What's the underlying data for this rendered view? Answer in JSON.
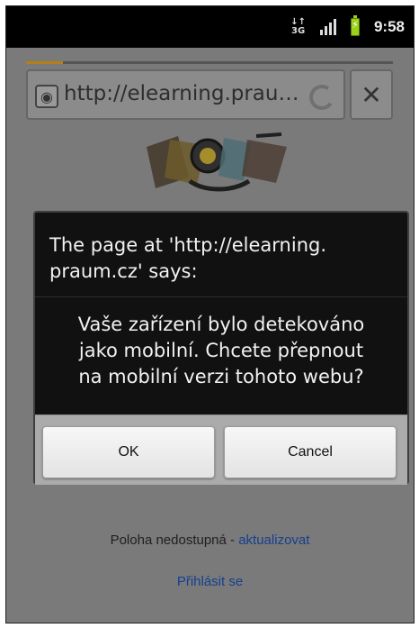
{
  "statusbar": {
    "data_icon": "3G",
    "time": "9:58"
  },
  "browser": {
    "url": "http://elearning.prau…",
    "progress": 0.1
  },
  "dialog": {
    "title": "The page at 'http://elearning.\npraum.cz' says:",
    "message": "Vaše zařízení bylo detekováno\njako mobilní. Chcete přepnout\nna mobilní verzi tohoto webu?",
    "ok_label": "OK",
    "cancel_label": "Cancel"
  },
  "page": {
    "location_text": "Poloha nedostupná - ",
    "location_link": "aktualizovat",
    "login_link": "Přihlásit se"
  },
  "icons": {
    "status_data": "data-icon",
    "signal": "signal-icon",
    "battery": "battery-charging-icon",
    "globe": "globe-icon",
    "reload": "reload-icon",
    "close": "close-icon",
    "search": "search-icon"
  }
}
